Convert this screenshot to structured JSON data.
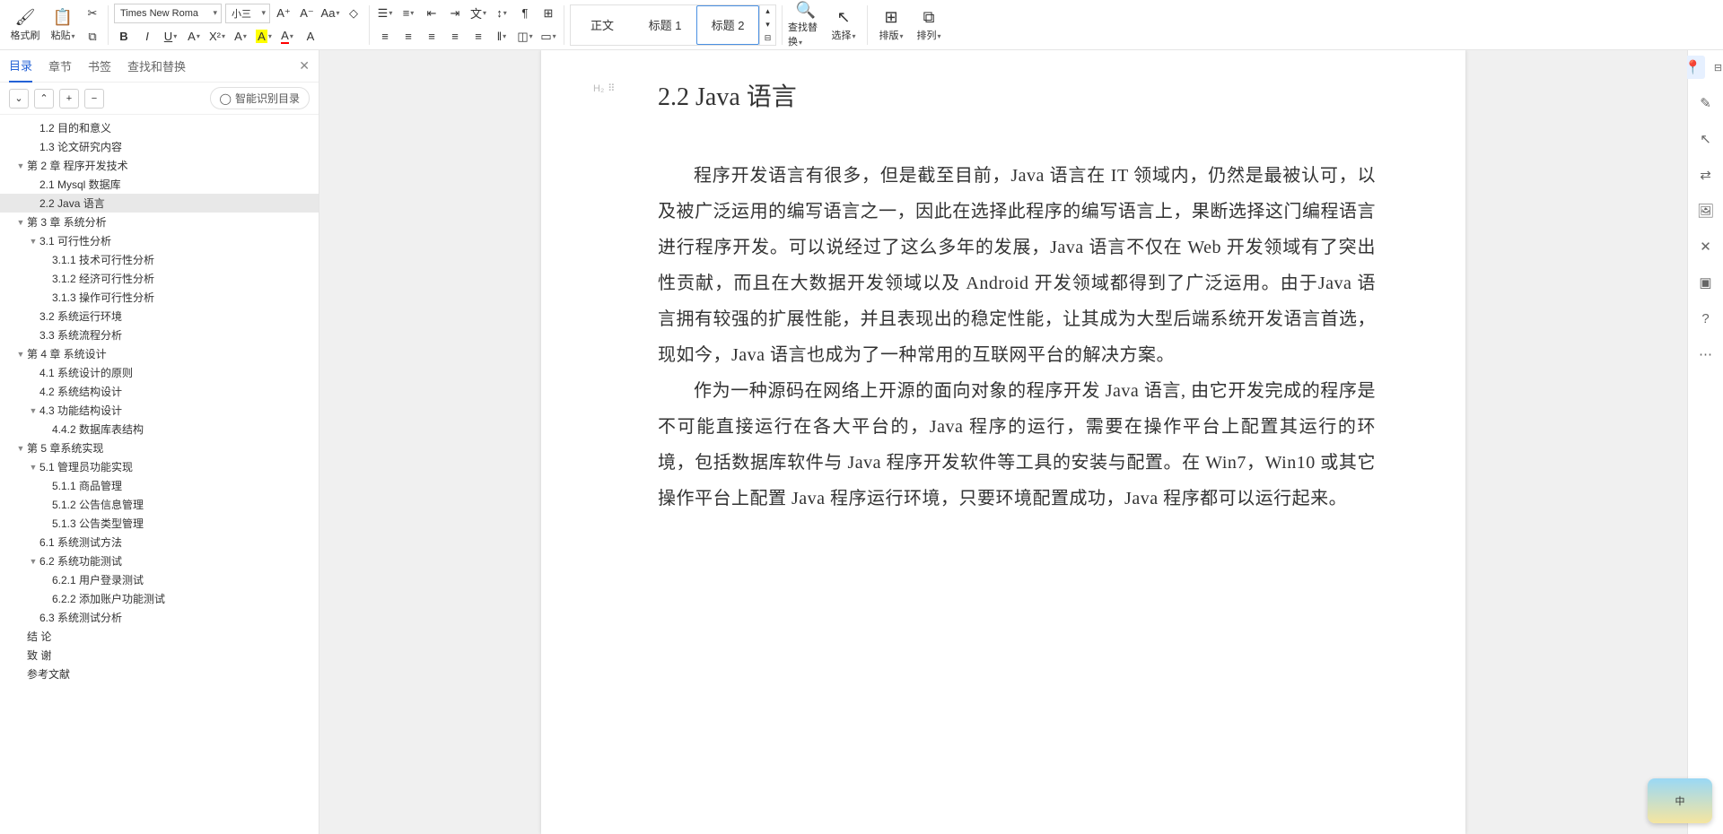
{
  "toolbar": {
    "format_painter": "格式刷",
    "paste": "粘贴",
    "font_name": "Times New Roma",
    "font_size": "小三",
    "styles": {
      "normal": "正文",
      "h1": "标题 1",
      "h2": "标题 2"
    },
    "find_replace": "查找替换",
    "select": "选择",
    "layout": "排版",
    "arrange": "排列"
  },
  "sidebar": {
    "tabs": [
      "目录",
      "章节",
      "书签",
      "查找和替换"
    ],
    "smart": "智能识别目录",
    "outline": [
      {
        "lvl": 2,
        "text": "1.2 目的和意义",
        "tw": "",
        "cut": true
      },
      {
        "lvl": 2,
        "text": "1.3 论文研究内容",
        "tw": ""
      },
      {
        "lvl": 1,
        "text": "第 2 章 程序开发技术",
        "tw": "▼"
      },
      {
        "lvl": 2,
        "text": "2.1 Mysql 数据库",
        "tw": ""
      },
      {
        "lvl": 2,
        "text": "2.2 Java 语言",
        "tw": "",
        "sel": true
      },
      {
        "lvl": 1,
        "text": "第 3 章 系统分析",
        "tw": "▼"
      },
      {
        "lvl": 2,
        "text": "3.1 可行性分析",
        "tw": "▼"
      },
      {
        "lvl": 3,
        "text": "3.1.1 技术可行性分析",
        "tw": ""
      },
      {
        "lvl": 3,
        "text": "3.1.2 经济可行性分析",
        "tw": ""
      },
      {
        "lvl": 3,
        "text": "3.1.3 操作可行性分析",
        "tw": ""
      },
      {
        "lvl": 2,
        "text": "3.2 系统运行环境",
        "tw": ""
      },
      {
        "lvl": 2,
        "text": "3.3 系统流程分析",
        "tw": ""
      },
      {
        "lvl": 1,
        "text": "第 4 章 系统设计",
        "tw": "▼"
      },
      {
        "lvl": 2,
        "text": "4.1 系统设计的原则",
        "tw": ""
      },
      {
        "lvl": 2,
        "text": "4.2 系统结构设计",
        "tw": ""
      },
      {
        "lvl": 2,
        "text": "4.3 功能结构设计",
        "tw": "▼"
      },
      {
        "lvl": 3,
        "text": "4.4.2 数据库表结构",
        "tw": ""
      },
      {
        "lvl": 1,
        "text": "第 5 章系统实现",
        "tw": "▼"
      },
      {
        "lvl": 2,
        "text": "5.1 管理员功能实现",
        "tw": "▼"
      },
      {
        "lvl": 3,
        "text": "5.1.1 商品管理",
        "tw": ""
      },
      {
        "lvl": 3,
        "text": "5.1.2 公告信息管理",
        "tw": ""
      },
      {
        "lvl": 3,
        "text": "5.1.3 公告类型管理",
        "tw": ""
      },
      {
        "lvl": 2,
        "text": "6.1 系统测试方法",
        "tw": ""
      },
      {
        "lvl": 2,
        "text": "6.2 系统功能测试",
        "tw": "▼"
      },
      {
        "lvl": 3,
        "text": "6.2.1 用户登录测试",
        "tw": ""
      },
      {
        "lvl": 3,
        "text": "6.2.2 添加账户功能测试",
        "tw": ""
      },
      {
        "lvl": 2,
        "text": "6.3 系统测试分析",
        "tw": ""
      },
      {
        "lvl": 1,
        "text": "结 论",
        "tw": ""
      },
      {
        "lvl": 1,
        "text": "致 谢",
        "tw": ""
      },
      {
        "lvl": 1,
        "text": "参考文献",
        "tw": ""
      }
    ]
  },
  "doc": {
    "gutter": "H₂",
    "heading": "2.2 Java 语言",
    "p1": "程序开发语言有很多，但是截至目前，Java 语言在 IT 领域内，仍然是最被认可，以及被广泛运用的编写语言之一，因此在选择此程序的编写语言上，果断选择这门编程语言进行程序开发。可以说经过了这么多年的发展，Java 语言不仅在 Web 开发领域有了突出性贡献，而且在大数据开发领域以及 Android 开发领域都得到了广泛运用。由于Java 语言拥有较强的扩展性能，并且表现出的稳定性能，让其成为大型后端系统开发语言首选，现如今，Java 语言也成为了一种常用的互联网平台的解决方案。",
    "p2": "作为一种源码在网络上开源的面向对象的程序开发 Java 语言, 由它开发完成的程序是不可能直接运行在各大平台的，Java 程序的运行，需要在操作平台上配置其运行的环境，包括数据库软件与 Java 程序开发软件等工具的安装与配置。在 Win7，Win10 或其它操作平台上配置 Java 程序运行环境，只要环境配置成功，Java 程序都可以运行起来。"
  },
  "float": "中"
}
